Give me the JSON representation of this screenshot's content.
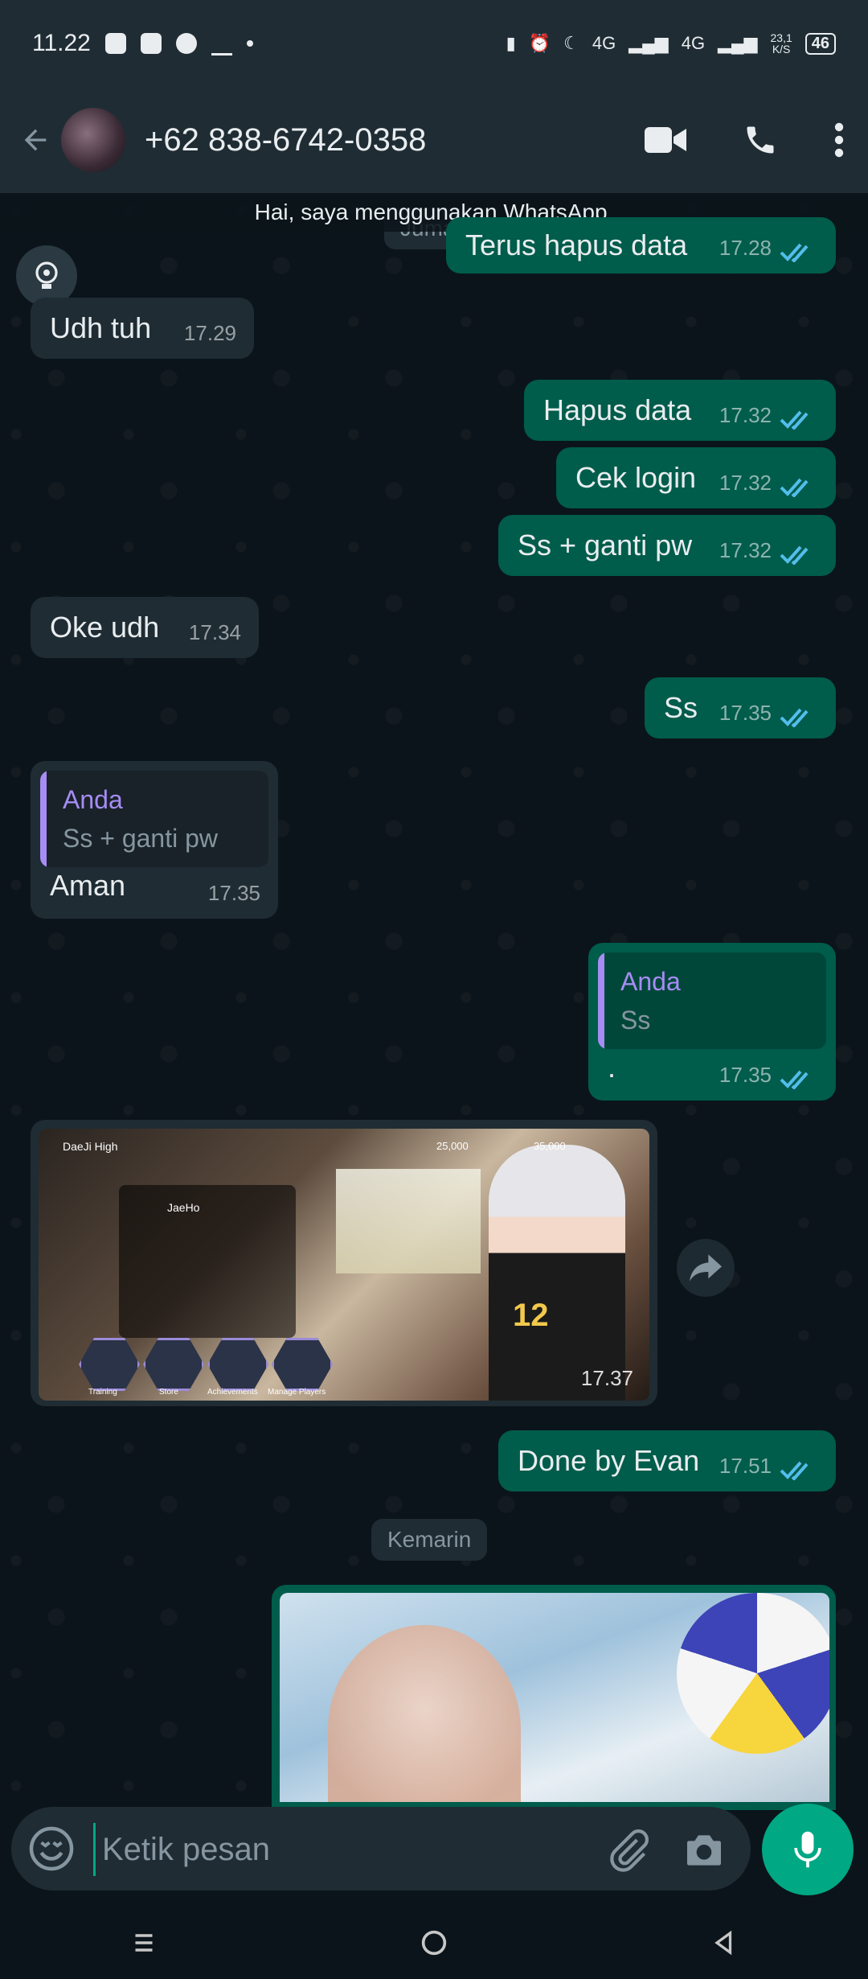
{
  "status_bar": {
    "time": "11.22",
    "speed_top": "23,1",
    "speed_bottom": "K/S",
    "battery": "46",
    "network1": "4G",
    "network2": "4G"
  },
  "header": {
    "contact": "+62 838-6742-0358"
  },
  "banner": "Hai, saya menggunakan WhatsApp.",
  "date_partial": "Jumat",
  "messages": [
    {
      "text": "Terus hapus data",
      "time": "17.28"
    },
    {
      "text": "Udh tuh",
      "time": "17.29"
    },
    {
      "text": "Hapus data",
      "time": "17.32"
    },
    {
      "text": "Cek login",
      "time": "17.32"
    },
    {
      "text": "Ss + ganti pw",
      "time": "17.32"
    },
    {
      "text": "Oke udh",
      "time": "17.34"
    },
    {
      "text": "Ss",
      "time": "17.35"
    },
    {
      "text": "Aman",
      "time": "17.35",
      "quote_name": "Anda",
      "quote_text": "Ss + ganti pw"
    },
    {
      "text": ".",
      "time": "17.35",
      "quote_name": "Anda",
      "quote_text": "Ss"
    },
    {
      "text": "Done by Evan",
      "time": "17.51"
    }
  ],
  "image_time": "17.37",
  "game_labels": {
    "school": "DaeJi High",
    "player": "JaeHo",
    "coins1": "25,000",
    "coins2": "35,000",
    "jersey": "12",
    "training": "Training",
    "store": "Store",
    "achievements": "Achievements",
    "manage": "Manage Players"
  },
  "date_chip": "Kemarin",
  "composer": {
    "placeholder": "Ketik pesan"
  },
  "colors": {
    "incoming": "#1f2c34",
    "outgoing": "#005c4b",
    "accent": "#00a884",
    "read_ticks": "#53bdeb",
    "quote_name": "#a68cf3"
  }
}
